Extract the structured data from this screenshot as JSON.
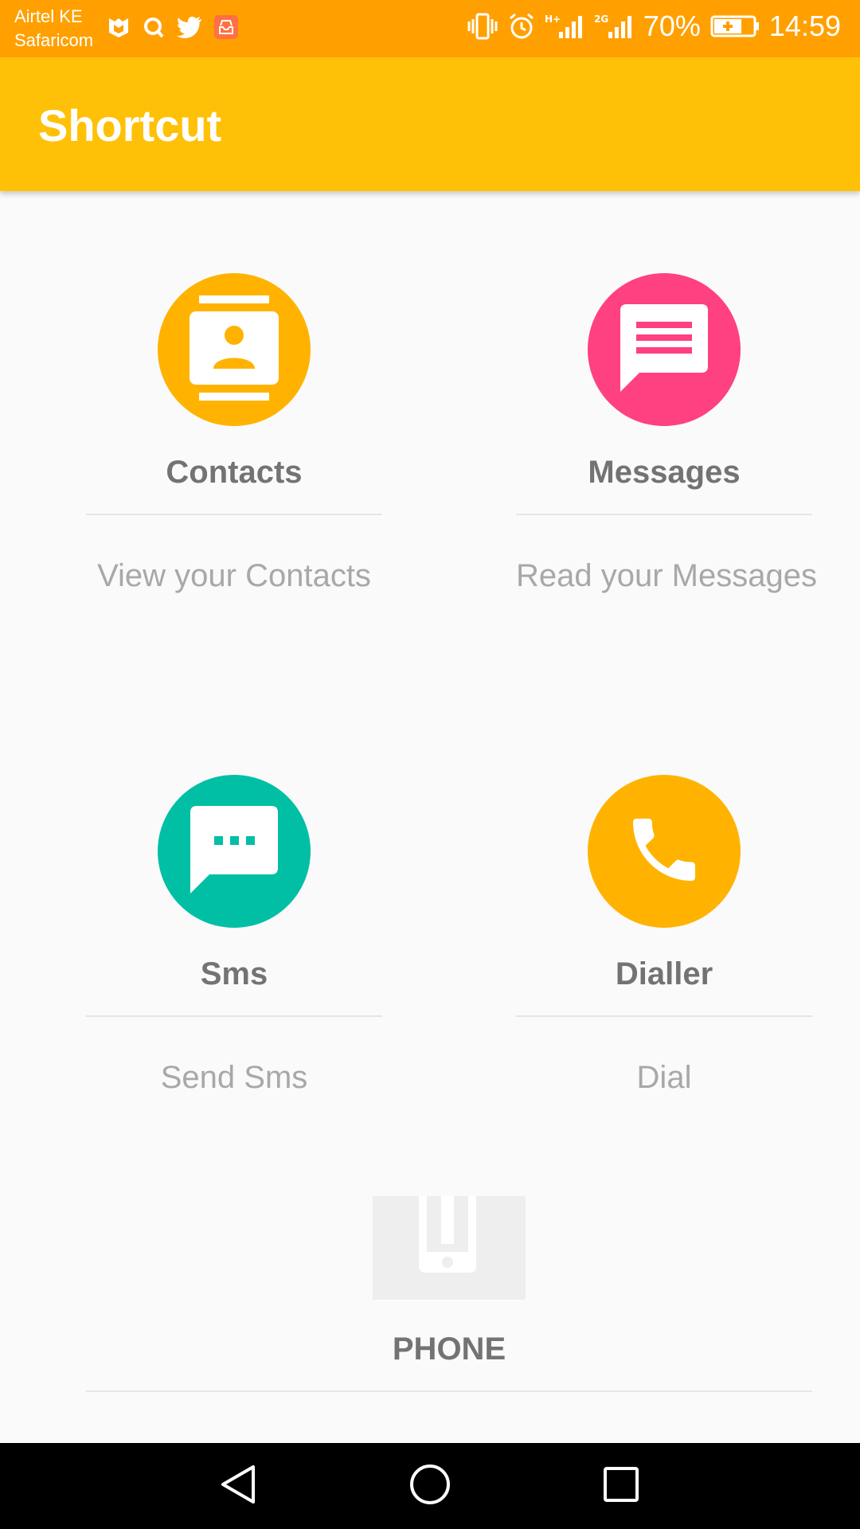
{
  "status_bar": {
    "carrier_line1": "Airtel KE",
    "carrier_line2": "Safaricom",
    "battery": "70%",
    "time": "14:59",
    "left_icons": [
      "mcafee-icon",
      "q-icon",
      "twitter-icon",
      "inbox-icon"
    ],
    "right_icons": [
      "vibrate-icon",
      "alarm-icon",
      "signal-hplus-icon",
      "signal-2g-icon",
      "battery-charging-icon"
    ],
    "color": "#ffa000"
  },
  "app_bar": {
    "title": "Shortcut",
    "color": "#ffc107"
  },
  "tiles": [
    {
      "title": "Contacts",
      "subtitle": "View your Contacts",
      "icon": "contacts-icon",
      "color": "#ffb300"
    },
    {
      "title": "Messages",
      "subtitle": "Read your Messages",
      "icon": "message-icon",
      "color": "#ff4081"
    },
    {
      "title": "Sms",
      "subtitle": "Send Sms",
      "icon": "sms-icon",
      "color": "#00bfa5"
    },
    {
      "title": "Dialler",
      "subtitle": "Dial",
      "icon": "phone-call-icon",
      "color": "#ffb300"
    }
  ],
  "phone": {
    "title": "PHONE",
    "icon": "phone-device-icon"
  },
  "nav_bar": {
    "buttons": [
      "back-icon",
      "home-icon",
      "recents-icon"
    ]
  }
}
